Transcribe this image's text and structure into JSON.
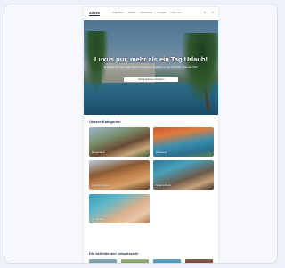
{
  "site": {
    "logo": "Allsea",
    "nav_links": [
      "Angebote",
      "Hotels",
      "Reiseziele",
      "Kontakt",
      "Über uns"
    ],
    "icons": [
      "search-icon",
      "user-icon"
    ]
  },
  "hero": {
    "title": "Luxus pur, mehr als ein Tag Urlaub!",
    "subtitle": "Entdecken Sie traumhafte Hotels und exklusive Angebote an den schönsten Orten der Welt.",
    "button_label": "Jetzt Angebote entdecken"
  },
  "categories": {
    "title": "Unsere Kategorien",
    "items": [
      {
        "label": "Bergurlaub"
      },
      {
        "label": "Wellness"
      },
      {
        "label": "Familienhotels"
      },
      {
        "label": "Strandurlaub"
      },
      {
        "label": "Romantik"
      }
    ]
  },
  "featured": {
    "title": "Die beliebtesten Urlaubsziele"
  }
}
